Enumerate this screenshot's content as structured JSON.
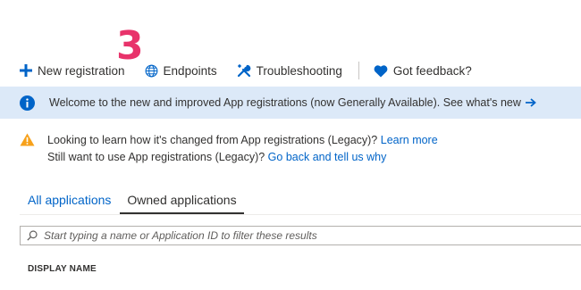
{
  "step_number": "3",
  "toolbar": {
    "new_registration": "New registration",
    "endpoints": "Endpoints",
    "troubleshooting": "Troubleshooting",
    "feedback": "Got feedback?"
  },
  "info_bar": {
    "message": "Welcome to the new and improved App registrations (now Generally Available). See what's new",
    "background": "#dce9f8",
    "icon": "info-icon"
  },
  "warning": {
    "line1_text": "Looking to learn how it's changed from App registrations (Legacy)?",
    "line1_link": "Learn more",
    "line2_text": "Still want to use App registrations (Legacy)?",
    "line2_link": "Go back and tell us why",
    "icon": "warning-icon"
  },
  "tabs": [
    {
      "label": "All applications",
      "active": false
    },
    {
      "label": "Owned applications",
      "active": true
    }
  ],
  "search": {
    "placeholder": "Start typing a name or Application ID to filter these results"
  },
  "table": {
    "columns": [
      "DISPLAY NAME"
    ]
  },
  "colors": {
    "accent": "#0064c8",
    "step_marker": "#e8336b",
    "warning": "#f7a11a"
  }
}
